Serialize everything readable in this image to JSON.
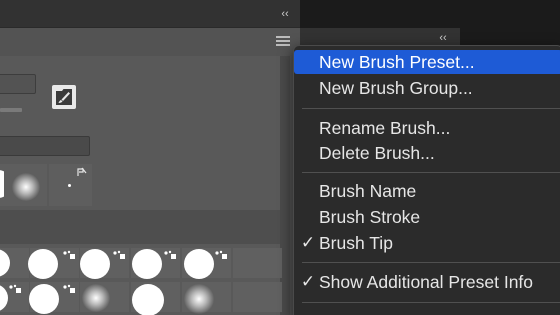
{
  "panel": {
    "collapse_glyph": "‹‹",
    "menu_icon": "panel-menu-icon",
    "brush_settings_icon": "brush-settings-icon",
    "preset_flag_icon": "preset-flag-icon"
  },
  "panel2": {
    "collapse_glyph": "‹‹"
  },
  "context_menu": {
    "items": [
      {
        "label": "New Brush Preset...",
        "checked": false,
        "highlighted": true
      },
      {
        "label": "New Brush Group...",
        "checked": false,
        "highlighted": false
      },
      {
        "label": "Rename Brush...",
        "checked": false,
        "highlighted": false
      },
      {
        "label": "Delete Brush...",
        "checked": false,
        "highlighted": false
      },
      {
        "label": "Brush Name",
        "checked": false,
        "highlighted": false
      },
      {
        "label": "Brush Stroke",
        "checked": false,
        "highlighted": false
      },
      {
        "label": "Brush Tip",
        "checked": true,
        "highlighted": false
      },
      {
        "label": "Show Additional Preset Info",
        "checked": true,
        "highlighted": false
      }
    ],
    "check_glyph": "✓"
  },
  "colors": {
    "highlight": "#1e5bd6",
    "menu_bg": "#2b2b2b",
    "panel_bg": "#535353"
  }
}
